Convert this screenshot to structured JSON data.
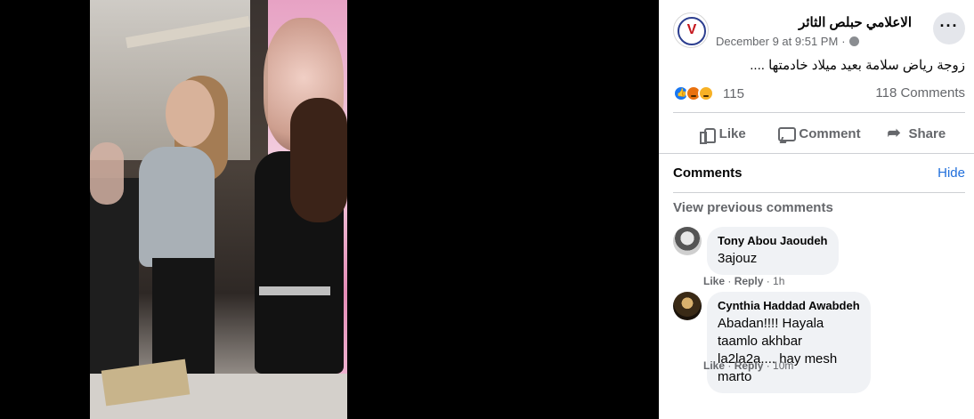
{
  "post": {
    "page_name": "الاعلامي حبلص الثائر",
    "timestamp": "December 9 at 9:51 PM",
    "separator": "·",
    "text": "زوجة رياض سلامة بعيد ميلاد خادمتها ....",
    "reaction_count": "115",
    "comment_count": "118 Comments",
    "reaction_types": [
      "like",
      "angry",
      "haha"
    ]
  },
  "actions": {
    "like": "Like",
    "comment": "Comment",
    "share": "Share"
  },
  "comments_section": {
    "title": "Comments",
    "hide": "Hide",
    "view_previous": "View previous comments",
    "items": [
      {
        "author": "Tony Abou Jaoudeh",
        "text": "3ajouz",
        "like": "Like",
        "reply": "Reply",
        "time": "1h"
      },
      {
        "author": "Cynthia Haddad Awabdeh",
        "text": "Abadan!!!! Hayala taamlo akhbar\nla2la2a.... hay mesh marto",
        "like": "Like",
        "reply": "Reply",
        "time": "10m"
      }
    ]
  },
  "colors": {
    "accent": "#216fdb",
    "like_blue": "#1877f2",
    "secondary_text": "#65676b",
    "bubble_bg": "#f0f2f5"
  }
}
